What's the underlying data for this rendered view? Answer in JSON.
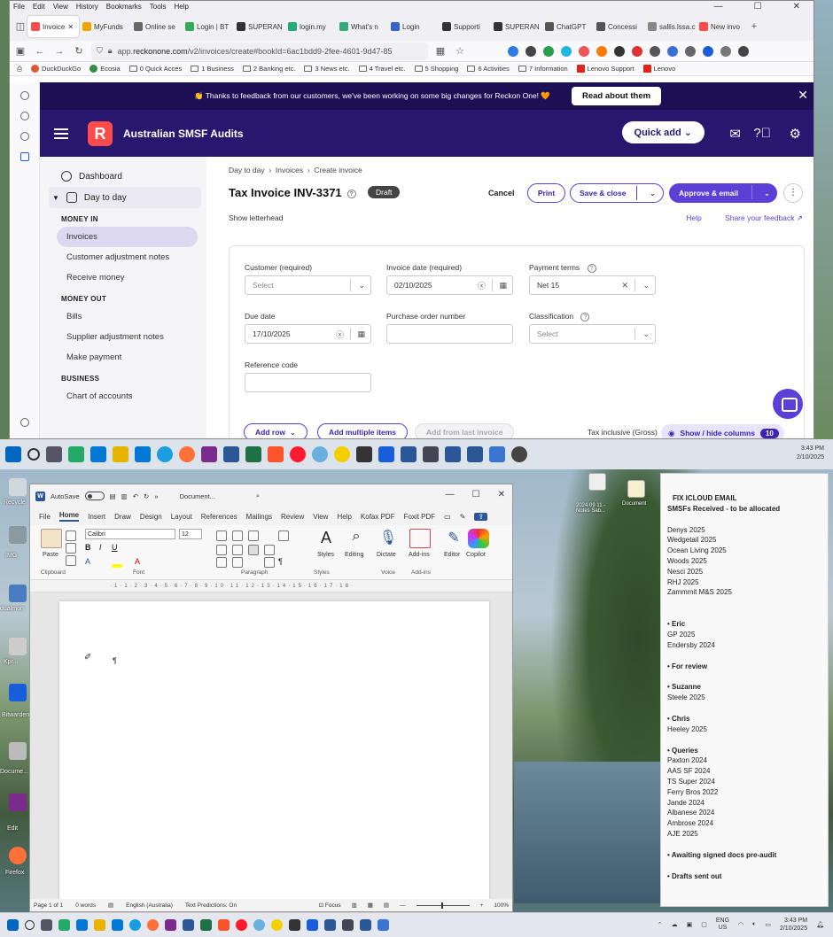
{
  "browser": {
    "menu": [
      "File",
      "Edit",
      "View",
      "History",
      "Bookmarks",
      "Tools",
      "Help"
    ],
    "tabs": [
      {
        "label": "Invoice",
        "color": "#ff4b4b",
        "active": true
      },
      {
        "label": "MyFunds",
        "color": "#f0a500"
      },
      {
        "label": "Online se",
        "color": "#666"
      },
      {
        "label": "Login | BT",
        "color": "#3a5"
      },
      {
        "label": "SUPERAN",
        "color": "#333"
      },
      {
        "label": "login.my",
        "color": "#2a7"
      },
      {
        "label": "What's n",
        "color": "#3a7"
      },
      {
        "label": "Login",
        "color": "#36c"
      },
      {
        "label": "Supporti",
        "color": "#333"
      },
      {
        "label": "SUPERAN",
        "color": "#333"
      },
      {
        "label": "ChatGPT",
        "color": "#555"
      },
      {
        "label": "Concessi",
        "color": "#555"
      },
      {
        "label": "sallis.lssa.com",
        "color": "#888"
      },
      {
        "label": "New invo",
        "color": "#ff4b4b"
      }
    ],
    "url_prefix": "app.",
    "url_host": "reckonone.com",
    "url_path": "/v2/invoices/create#bookId=6ac1bdd9-2fee-4601-9d47-85",
    "bookmarks": [
      "DuckDuckGo",
      "Ecosia",
      "0 Quick Acces",
      "1 Business",
      "2 Banking etc.",
      "3 News etc.",
      "4 Travel etc.",
      "5 Shopping",
      "6 Activities",
      "7 Information",
      "Lenovo Support",
      "Lenovo"
    ]
  },
  "reckon": {
    "banner_text": "👏 Thanks to feedback from our customers, we've been working on some big changes for Reckon One! 🧡",
    "banner_button": "Read about them",
    "logo_letter": "R",
    "company": "Australian SMSF Audits",
    "quick_add": "Quick add",
    "nav": {
      "dashboard": "Dashboard",
      "day_to_day": "Day to day",
      "money_in": "MONEY IN",
      "invoices": "Invoices",
      "customer_adj": "Customer adjustment notes",
      "receive_money": "Receive money",
      "money_out": "MONEY OUT",
      "bills": "Bills",
      "supplier_adj": "Supplier adjustment notes",
      "make_payment": "Make payment",
      "business": "BUSINESS",
      "chart_accounts": "Chart of accounts"
    },
    "breadcrumb": [
      "Day to day",
      "Invoices",
      "Create invoice"
    ],
    "title": "Tax Invoice INV-3371",
    "status": "Draft",
    "cancel": "Cancel",
    "print": "Print",
    "save_close": "Save & close",
    "approve_email": "Approve & email",
    "show_letterhead": "Show letterhead",
    "help": "Help",
    "feedback": "Share your feedback",
    "fields": {
      "customer_label": "Customer (required)",
      "customer_ph": "Select",
      "invoice_date_label": "Invoice date (required)",
      "invoice_date": "02/10/2025",
      "payment_terms_label": "Payment terms",
      "payment_terms": "Net 15",
      "due_date_label": "Due date",
      "due_date": "17/10/2025",
      "po_label": "Purchase order number",
      "classification_label": "Classification",
      "classification_ph": "Select",
      "reference_label": "Reference code"
    },
    "add_row": "Add row",
    "add_multiple": "Add multiple items",
    "add_last": "Add from last invoice",
    "tax_mode": "Tax inclusive (Gross)",
    "show_hide": "Show / hide columns",
    "columns_count": "10"
  },
  "taskbar": {
    "time": "3:43 PM",
    "date": "2/10/2025",
    "lang": "ENG",
    "region": "US"
  },
  "desktop": {
    "icons": [
      "Recycle",
      "IMG",
      "dualmon",
      "Kpr...",
      "Bitwarden",
      "Docume...",
      "Edit",
      "Firefox"
    ],
    "file_icons": [
      "2024 09 11 - Notes Sab...",
      "Document"
    ]
  },
  "word": {
    "autosave": "AutoSave",
    "doc_title": "Document...",
    "tabs": [
      "File",
      "Home",
      "Insert",
      "Draw",
      "Design",
      "Layout",
      "References",
      "Mailings",
      "Review",
      "View",
      "Help",
      "Kofax PDF",
      "Foxit PDF"
    ],
    "font": "Calibri",
    "size": "12",
    "groups": [
      "Clipboard",
      "Font",
      "Paragraph",
      "Styles",
      "Voice",
      "Add-ins"
    ],
    "paste": "Paste",
    "styles": "Styles",
    "editing": "Editing",
    "dictate": "Dictate",
    "addins": "Add-ins",
    "editor": "Editor",
    "copilot": "Copilot",
    "status_page": "Page 1 of 1",
    "status_words": "0 words",
    "status_lang": "English (Australia)",
    "status_pred": "Text Predictions: On",
    "status_focus": "Focus",
    "zoom": "100%"
  },
  "note": {
    "title": "FIX ICLOUD EMAIL",
    "subtitle": "SMSFs Received - to be allocated",
    "received": [
      "Denys 2025",
      "Wedgetail 2025",
      "Ocean Living 2025",
      "Woods 2025",
      "Nesci 2025",
      "RHJ 2025",
      "Zammmit M&S 2025"
    ],
    "eric_hd": "• Eric",
    "eric": [
      "GP 2025",
      "Endersby 2024"
    ],
    "review_hd": "• For review",
    "suzanne_hd": "• Suzanne",
    "suzanne": [
      "Steele 2025"
    ],
    "chris_hd": "• Chris",
    "chris": [
      "Heeley 2025"
    ],
    "queries_hd": "• Queries",
    "queries": [
      "Paxton 2024",
      "AAS SF 2024",
      "TS Super 2024",
      "Ferry Bros 2022",
      "Jande 2024",
      "Albanese 2024",
      "Ambrose 2024",
      "AJE 2025"
    ],
    "awaiting_hd": "• Awaiting signed docs pre-audit",
    "drafts_hd": "• Drafts sent out"
  },
  "colors": {
    "reckon_banner": "#1c0f54",
    "reckon_appbar": "#28176e",
    "reckon_accent": "#5b3fd6",
    "reckon_logo": "#ff4b4b"
  }
}
